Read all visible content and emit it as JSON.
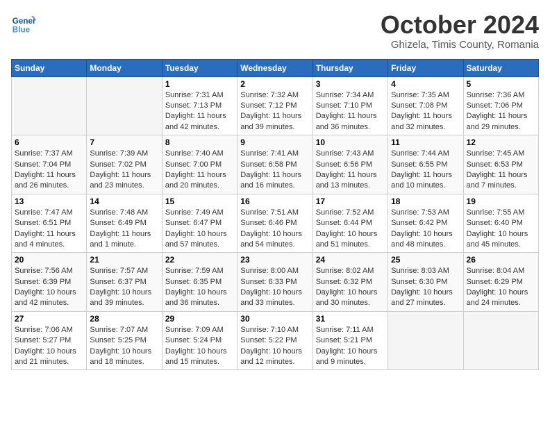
{
  "header": {
    "logo_line1": "General",
    "logo_line2": "Blue",
    "month": "October 2024",
    "location": "Ghizela, Timis County, Romania"
  },
  "weekdays": [
    "Sunday",
    "Monday",
    "Tuesday",
    "Wednesday",
    "Thursday",
    "Friday",
    "Saturday"
  ],
  "weeks": [
    [
      {
        "day": "",
        "info": ""
      },
      {
        "day": "",
        "info": ""
      },
      {
        "day": "1",
        "info": "Sunrise: 7:31 AM\nSunset: 7:13 PM\nDaylight: 11 hours and 42 minutes."
      },
      {
        "day": "2",
        "info": "Sunrise: 7:32 AM\nSunset: 7:12 PM\nDaylight: 11 hours and 39 minutes."
      },
      {
        "day": "3",
        "info": "Sunrise: 7:34 AM\nSunset: 7:10 PM\nDaylight: 11 hours and 36 minutes."
      },
      {
        "day": "4",
        "info": "Sunrise: 7:35 AM\nSunset: 7:08 PM\nDaylight: 11 hours and 32 minutes."
      },
      {
        "day": "5",
        "info": "Sunrise: 7:36 AM\nSunset: 7:06 PM\nDaylight: 11 hours and 29 minutes."
      }
    ],
    [
      {
        "day": "6",
        "info": "Sunrise: 7:37 AM\nSunset: 7:04 PM\nDaylight: 11 hours and 26 minutes."
      },
      {
        "day": "7",
        "info": "Sunrise: 7:39 AM\nSunset: 7:02 PM\nDaylight: 11 hours and 23 minutes."
      },
      {
        "day": "8",
        "info": "Sunrise: 7:40 AM\nSunset: 7:00 PM\nDaylight: 11 hours and 20 minutes."
      },
      {
        "day": "9",
        "info": "Sunrise: 7:41 AM\nSunset: 6:58 PM\nDaylight: 11 hours and 16 minutes."
      },
      {
        "day": "10",
        "info": "Sunrise: 7:43 AM\nSunset: 6:56 PM\nDaylight: 11 hours and 13 minutes."
      },
      {
        "day": "11",
        "info": "Sunrise: 7:44 AM\nSunset: 6:55 PM\nDaylight: 11 hours and 10 minutes."
      },
      {
        "day": "12",
        "info": "Sunrise: 7:45 AM\nSunset: 6:53 PM\nDaylight: 11 hours and 7 minutes."
      }
    ],
    [
      {
        "day": "13",
        "info": "Sunrise: 7:47 AM\nSunset: 6:51 PM\nDaylight: 11 hours and 4 minutes."
      },
      {
        "day": "14",
        "info": "Sunrise: 7:48 AM\nSunset: 6:49 PM\nDaylight: 11 hours and 1 minute."
      },
      {
        "day": "15",
        "info": "Sunrise: 7:49 AM\nSunset: 6:47 PM\nDaylight: 10 hours and 57 minutes."
      },
      {
        "day": "16",
        "info": "Sunrise: 7:51 AM\nSunset: 6:46 PM\nDaylight: 10 hours and 54 minutes."
      },
      {
        "day": "17",
        "info": "Sunrise: 7:52 AM\nSunset: 6:44 PM\nDaylight: 10 hours and 51 minutes."
      },
      {
        "day": "18",
        "info": "Sunrise: 7:53 AM\nSunset: 6:42 PM\nDaylight: 10 hours and 48 minutes."
      },
      {
        "day": "19",
        "info": "Sunrise: 7:55 AM\nSunset: 6:40 PM\nDaylight: 10 hours and 45 minutes."
      }
    ],
    [
      {
        "day": "20",
        "info": "Sunrise: 7:56 AM\nSunset: 6:39 PM\nDaylight: 10 hours and 42 minutes."
      },
      {
        "day": "21",
        "info": "Sunrise: 7:57 AM\nSunset: 6:37 PM\nDaylight: 10 hours and 39 minutes."
      },
      {
        "day": "22",
        "info": "Sunrise: 7:59 AM\nSunset: 6:35 PM\nDaylight: 10 hours and 36 minutes."
      },
      {
        "day": "23",
        "info": "Sunrise: 8:00 AM\nSunset: 6:33 PM\nDaylight: 10 hours and 33 minutes."
      },
      {
        "day": "24",
        "info": "Sunrise: 8:02 AM\nSunset: 6:32 PM\nDaylight: 10 hours and 30 minutes."
      },
      {
        "day": "25",
        "info": "Sunrise: 8:03 AM\nSunset: 6:30 PM\nDaylight: 10 hours and 27 minutes."
      },
      {
        "day": "26",
        "info": "Sunrise: 8:04 AM\nSunset: 6:29 PM\nDaylight: 10 hours and 24 minutes."
      }
    ],
    [
      {
        "day": "27",
        "info": "Sunrise: 7:06 AM\nSunset: 5:27 PM\nDaylight: 10 hours and 21 minutes."
      },
      {
        "day": "28",
        "info": "Sunrise: 7:07 AM\nSunset: 5:25 PM\nDaylight: 10 hours and 18 minutes."
      },
      {
        "day": "29",
        "info": "Sunrise: 7:09 AM\nSunset: 5:24 PM\nDaylight: 10 hours and 15 minutes."
      },
      {
        "day": "30",
        "info": "Sunrise: 7:10 AM\nSunset: 5:22 PM\nDaylight: 10 hours and 12 minutes."
      },
      {
        "day": "31",
        "info": "Sunrise: 7:11 AM\nSunset: 5:21 PM\nDaylight: 10 hours and 9 minutes."
      },
      {
        "day": "",
        "info": ""
      },
      {
        "day": "",
        "info": ""
      }
    ]
  ]
}
